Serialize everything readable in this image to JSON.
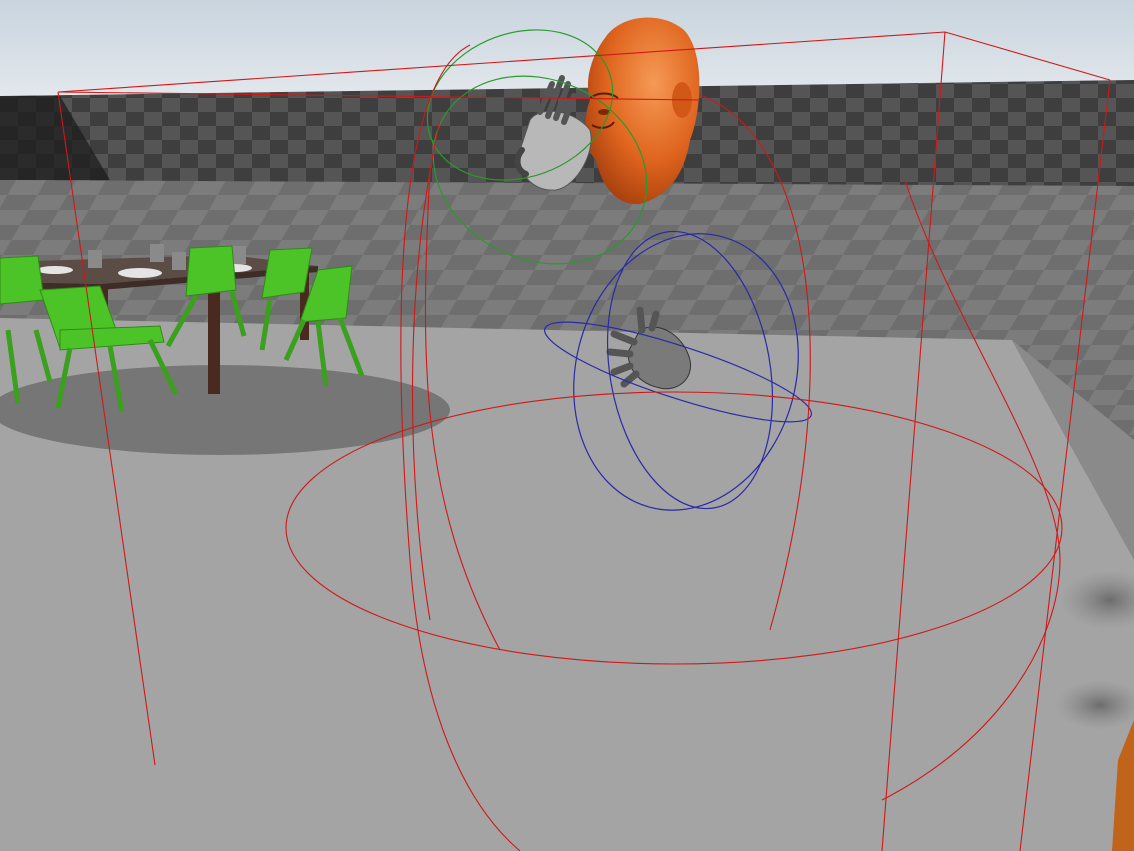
{
  "viewport": {
    "description_color_sky": "#d6dee6",
    "description_color_floor": "#a5a5a5",
    "wall_check_dark": "#3c3c3c",
    "wall_check_light": "#5a5a5a"
  },
  "colors": {
    "bounds_red": "#d01818",
    "gizmo_green": "#2a9a2a",
    "gizmo_blue": "#2a2aa0",
    "head_skin": "#e0661e",
    "hand_grey": "#6e6e6e",
    "chair_green": "#4fc828",
    "table_top": "#5a4a42",
    "table_leg": "#4a2c22",
    "post_orange": "#c0641c"
  },
  "objects": {
    "head": "head-model",
    "left_hand": "left-hand-model",
    "right_hand": "right-hand-model",
    "table": "dining-table",
    "chairs": "green-chairs"
  }
}
